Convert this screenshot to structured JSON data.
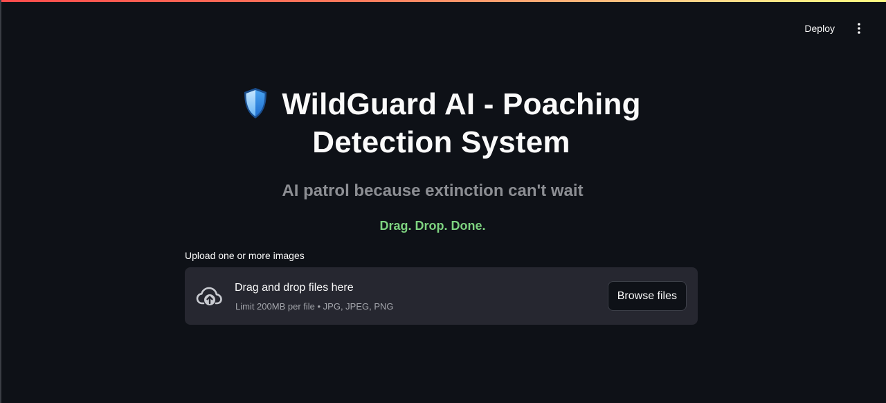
{
  "header": {
    "deploy_label": "Deploy",
    "menu_icon": "kebab-vertical-icon"
  },
  "title": {
    "icon": "shield-icon",
    "line1": "WildGuard AI - Poaching",
    "line2": "Detection System"
  },
  "subtitle": "AI patrol because extinction can't wait",
  "tagline": "Drag. Drop. Done.",
  "colors": {
    "background": "#0e1117",
    "dropzone": "#262730",
    "tagline": "#7ed380",
    "subtitle": "#8c8e93",
    "shield_light": "#9fd3ff",
    "shield_dark": "#2f86e6"
  },
  "uploader": {
    "label": "Upload one or more images",
    "drop_text": "Drag and drop files here",
    "limit_text": "Limit 200MB per file • JPG, JPEG, PNG",
    "browse_label": "Browse files",
    "icon": "cloud-upload-icon"
  }
}
